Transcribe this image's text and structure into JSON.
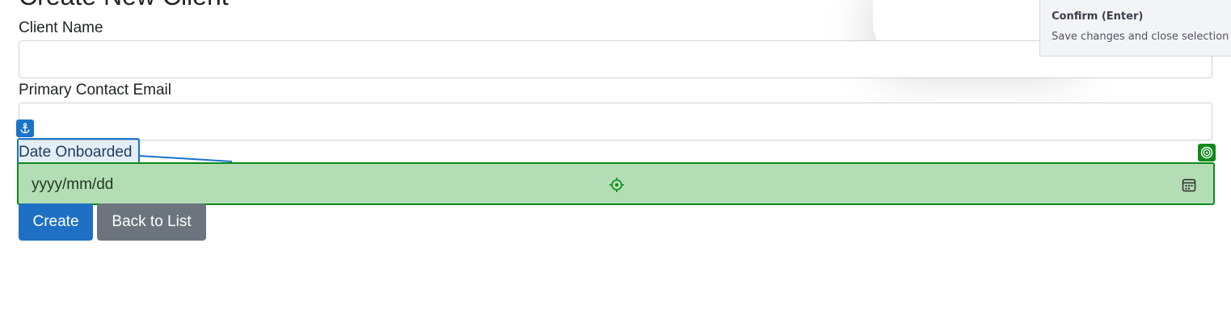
{
  "page": {
    "title": "Create New Client"
  },
  "form": {
    "client_name_label": "Client Name",
    "client_name_value": "",
    "email_label": "Primary Contact Email",
    "email_value": "",
    "date_label": "Date Onboarded",
    "date_placeholder": "yyyy/mm/dd"
  },
  "buttons": {
    "create_label": "Create",
    "back_label": "Back to List"
  },
  "tooltip": {
    "title": "Confirm (Enter)",
    "description": "Save changes and close selection"
  },
  "colors": {
    "anchor_highlight": "#1a73c8",
    "target_highlight": "#0f8a1a",
    "target_fill": "#b3ddb4",
    "primary_button": "#1f6fc5",
    "secondary_button": "#6c757d"
  },
  "icons": {
    "anchor": "anchor-icon",
    "target": "target-icon",
    "crosshair": "crosshair-icon",
    "calendar": "calendar-icon"
  }
}
